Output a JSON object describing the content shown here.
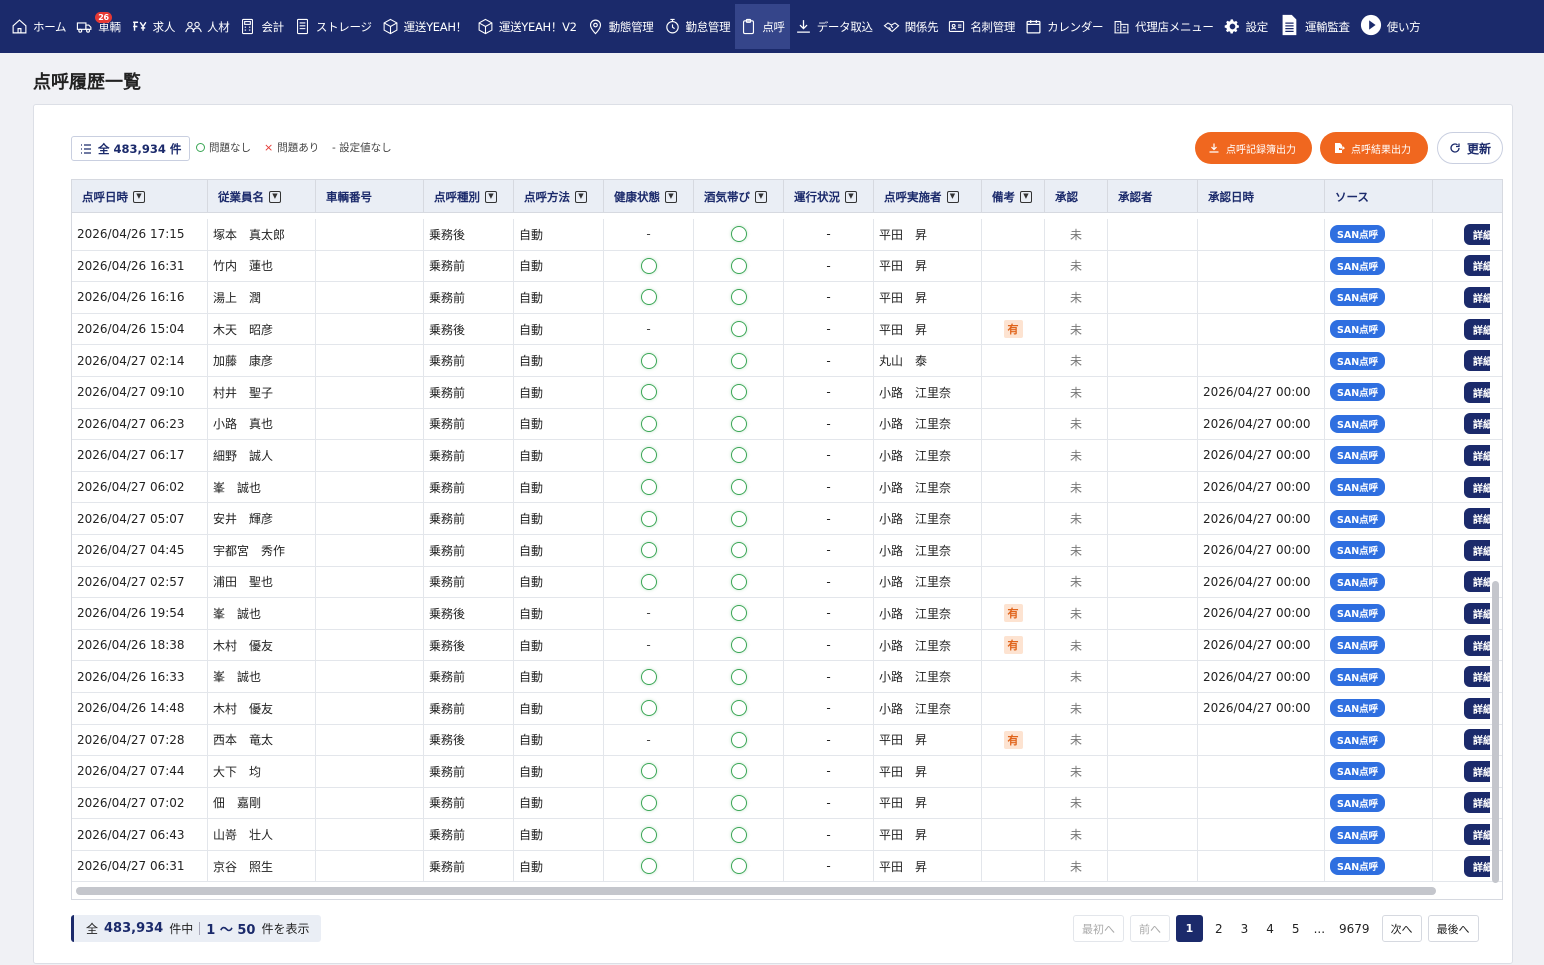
{
  "nav": {
    "home": "ホーム",
    "vehicles": "車輌",
    "vehicles_badge": "26",
    "jobs": "求人",
    "staff": "人材",
    "accounting": "会計",
    "storage": "ストレージ",
    "yeah": "運送YEAH！",
    "yeah_v2": "運送YEAH！V2",
    "operations": "動態管理",
    "attendance": "勤怠管理",
    "tenko": "点呼",
    "data_import": "データ取込",
    "partners": "関係先",
    "business_cards": "名刺管理",
    "calendar": "カレンダー",
    "agency_menu": "代理店メニュー",
    "settings": "設定",
    "audit": "運輸監査",
    "howto": "使い方"
  },
  "page": {
    "title": "点呼履歴一覧"
  },
  "toolbar": {
    "total_label": "全 483,934 件",
    "legend_ok": "問題なし",
    "legend_ng": "問題あり",
    "legend_ng_mark": "×",
    "legend_none": "- 設定値なし",
    "export_log_btn": "点呼記録簿出力",
    "export_result_btn": "点呼結果出力",
    "refresh_btn": "更新"
  },
  "table": {
    "columns": [
      "点呼日時",
      "従業員名",
      "車輌番号",
      "点呼種別",
      "点呼方法",
      "健康状態",
      "酒気帯び",
      "運行状況",
      "点呼実施者",
      "備考",
      "承認",
      "承認者",
      "承認日時",
      "ソース",
      ""
    ],
    "sortable": [
      true,
      true,
      false,
      true,
      true,
      true,
      true,
      true,
      true,
      true,
      false,
      false,
      false,
      false,
      false
    ],
    "detail_label": "詳細",
    "rows": [
      {
        "datetime": "2026/04/26 17:15",
        "name": "塚本　真太郎",
        "vehicle": "",
        "type": "乗務後",
        "method": "自動",
        "health": "-",
        "alcohol": "ok",
        "status": "-",
        "inspector": "平田　昇",
        "note": "",
        "approved": "未",
        "approver": "",
        "approved_at": "",
        "source": "SAN点呼"
      },
      {
        "datetime": "2026/04/26 16:31",
        "name": "竹内　蓮也",
        "vehicle": "",
        "type": "乗務前",
        "method": "自動",
        "health": "ok",
        "alcohol": "ok",
        "status": "-",
        "inspector": "平田　昇",
        "note": "",
        "approved": "未",
        "approver": "",
        "approved_at": "",
        "source": "SAN点呼"
      },
      {
        "datetime": "2026/04/26 16:16",
        "name": "湯上　潤",
        "vehicle": "",
        "type": "乗務前",
        "method": "自動",
        "health": "ok",
        "alcohol": "ok",
        "status": "-",
        "inspector": "平田　昇",
        "note": "",
        "approved": "未",
        "approver": "",
        "approved_at": "",
        "source": "SAN点呼"
      },
      {
        "datetime": "2026/04/26 15:04",
        "name": "木天　昭彦",
        "vehicle": "",
        "type": "乗務後",
        "method": "自動",
        "health": "-",
        "alcohol": "ok",
        "status": "-",
        "inspector": "平田　昇",
        "note": "有",
        "approved": "未",
        "approver": "",
        "approved_at": "",
        "source": "SAN点呼"
      },
      {
        "datetime": "2026/04/27 02:14",
        "name": "加藤　康彦",
        "vehicle": "",
        "type": "乗務前",
        "method": "自動",
        "health": "ok",
        "alcohol": "ok",
        "status": "-",
        "inspector": "丸山　泰",
        "note": "",
        "approved": "未",
        "approver": "",
        "approved_at": "",
        "source": "SAN点呼"
      },
      {
        "datetime": "2026/04/27 09:10",
        "name": "村井　聖子",
        "vehicle": "",
        "type": "乗務前",
        "method": "自動",
        "health": "ok",
        "alcohol": "ok",
        "status": "-",
        "inspector": "小路　江里奈",
        "note": "",
        "approved": "未",
        "approver": "",
        "approved_at": "2026/04/27 00:00",
        "source": "SAN点呼"
      },
      {
        "datetime": "2026/04/27 06:23",
        "name": "小路　真也",
        "vehicle": "",
        "type": "乗務前",
        "method": "自動",
        "health": "ok",
        "alcohol": "ok",
        "status": "-",
        "inspector": "小路　江里奈",
        "note": "",
        "approved": "未",
        "approver": "",
        "approved_at": "2026/04/27 00:00",
        "source": "SAN点呼"
      },
      {
        "datetime": "2026/04/27 06:17",
        "name": "細野　誠人",
        "vehicle": "",
        "type": "乗務前",
        "method": "自動",
        "health": "ok",
        "alcohol": "ok",
        "status": "-",
        "inspector": "小路　江里奈",
        "note": "",
        "approved": "未",
        "approver": "",
        "approved_at": "2026/04/27 00:00",
        "source": "SAN点呼"
      },
      {
        "datetime": "2026/04/27 06:02",
        "name": "峯　誠也",
        "vehicle": "",
        "type": "乗務前",
        "method": "自動",
        "health": "ok",
        "alcohol": "ok",
        "status": "-",
        "inspector": "小路　江里奈",
        "note": "",
        "approved": "未",
        "approver": "",
        "approved_at": "2026/04/27 00:00",
        "source": "SAN点呼"
      },
      {
        "datetime": "2026/04/27 05:07",
        "name": "安井　輝彦",
        "vehicle": "",
        "type": "乗務前",
        "method": "自動",
        "health": "ok",
        "alcohol": "ok",
        "status": "-",
        "inspector": "小路　江里奈",
        "note": "",
        "approved": "未",
        "approver": "",
        "approved_at": "2026/04/27 00:00",
        "source": "SAN点呼"
      },
      {
        "datetime": "2026/04/27 04:45",
        "name": "宇都宮　秀作",
        "vehicle": "",
        "type": "乗務前",
        "method": "自動",
        "health": "ok",
        "alcohol": "ok",
        "status": "-",
        "inspector": "小路　江里奈",
        "note": "",
        "approved": "未",
        "approver": "",
        "approved_at": "2026/04/27 00:00",
        "source": "SAN点呼"
      },
      {
        "datetime": "2026/04/27 02:57",
        "name": "浦田　聖也",
        "vehicle": "",
        "type": "乗務前",
        "method": "自動",
        "health": "ok",
        "alcohol": "ok",
        "status": "-",
        "inspector": "小路　江里奈",
        "note": "",
        "approved": "未",
        "approver": "",
        "approved_at": "2026/04/27 00:00",
        "source": "SAN点呼"
      },
      {
        "datetime": "2026/04/26 19:54",
        "name": "峯　誠也",
        "vehicle": "",
        "type": "乗務後",
        "method": "自動",
        "health": "-",
        "alcohol": "ok",
        "status": "-",
        "inspector": "小路　江里奈",
        "note": "有",
        "approved": "未",
        "approver": "",
        "approved_at": "2026/04/27 00:00",
        "source": "SAN点呼"
      },
      {
        "datetime": "2026/04/26 18:38",
        "name": "木村　優友",
        "vehicle": "",
        "type": "乗務後",
        "method": "自動",
        "health": "-",
        "alcohol": "ok",
        "status": "-",
        "inspector": "小路　江里奈",
        "note": "有",
        "approved": "未",
        "approver": "",
        "approved_at": "2026/04/27 00:00",
        "source": "SAN点呼"
      },
      {
        "datetime": "2026/04/26 16:33",
        "name": "峯　誠也",
        "vehicle": "",
        "type": "乗務前",
        "method": "自動",
        "health": "ok",
        "alcohol": "ok",
        "status": "-",
        "inspector": "小路　江里奈",
        "note": "",
        "approved": "未",
        "approver": "",
        "approved_at": "2026/04/27 00:00",
        "source": "SAN点呼"
      },
      {
        "datetime": "2026/04/26 14:48",
        "name": "木村　優友",
        "vehicle": "",
        "type": "乗務前",
        "method": "自動",
        "health": "ok",
        "alcohol": "ok",
        "status": "-",
        "inspector": "小路　江里奈",
        "note": "",
        "approved": "未",
        "approver": "",
        "approved_at": "2026/04/27 00:00",
        "source": "SAN点呼"
      },
      {
        "datetime": "2026/04/27 07:28",
        "name": "西本　竜太",
        "vehicle": "",
        "type": "乗務後",
        "method": "自動",
        "health": "-",
        "alcohol": "ok",
        "status": "-",
        "inspector": "平田　昇",
        "note": "有",
        "approved": "未",
        "approver": "",
        "approved_at": "",
        "source": "SAN点呼"
      },
      {
        "datetime": "2026/04/27 07:44",
        "name": "大下　均",
        "vehicle": "",
        "type": "乗務前",
        "method": "自動",
        "health": "ok",
        "alcohol": "ok",
        "status": "-",
        "inspector": "平田　昇",
        "note": "",
        "approved": "未",
        "approver": "",
        "approved_at": "",
        "source": "SAN点呼"
      },
      {
        "datetime": "2026/04/27 07:02",
        "name": "佃　嘉剛",
        "vehicle": "",
        "type": "乗務前",
        "method": "自動",
        "health": "ok",
        "alcohol": "ok",
        "status": "-",
        "inspector": "平田　昇",
        "note": "",
        "approved": "未",
        "approver": "",
        "approved_at": "",
        "source": "SAN点呼"
      },
      {
        "datetime": "2026/04/27 06:43",
        "name": "山嵜　壮人",
        "vehicle": "",
        "type": "乗務前",
        "method": "自動",
        "health": "ok",
        "alcohol": "ok",
        "status": "-",
        "inspector": "平田　昇",
        "note": "",
        "approved": "未",
        "approver": "",
        "approved_at": "",
        "source": "SAN点呼"
      },
      {
        "datetime": "2026/04/27 06:31",
        "name": "京谷　照生",
        "vehicle": "",
        "type": "乗務前",
        "method": "自動",
        "health": "ok",
        "alcohol": "ok",
        "status": "-",
        "inspector": "平田　昇",
        "note": "",
        "approved": "未",
        "approver": "",
        "approved_at": "",
        "source": "SAN点呼"
      }
    ]
  },
  "footer": {
    "total_prefix": "全",
    "total_count": "483,934",
    "total_suffix": "件中",
    "range": "1 ～ 50",
    "range_suffix": "件を表示"
  },
  "pagination": {
    "first": "最初へ",
    "prev": "前へ",
    "pages": [
      "1",
      "2",
      "3",
      "4",
      "5"
    ],
    "ellipsis": "...",
    "last_page": "9679",
    "next": "次へ",
    "last": "最後へ"
  },
  "colors": {
    "nav_bg": "#1b2a6b",
    "accent_orange": "#f0671f",
    "ok_green": "#3aa655",
    "source_blue": "#2f6fe0"
  }
}
